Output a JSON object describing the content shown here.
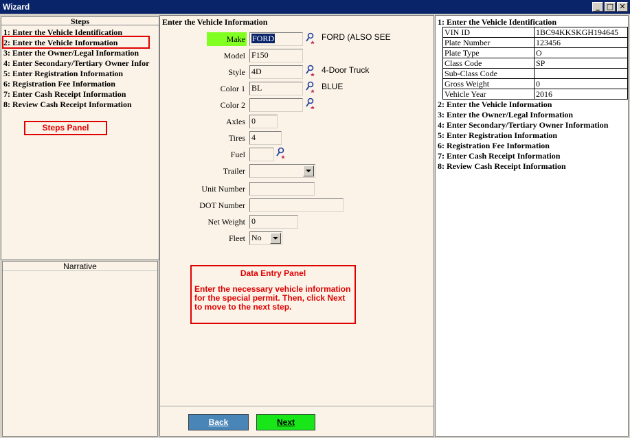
{
  "window": {
    "title": "Wizard",
    "controls": [
      "_",
      "□",
      "✕"
    ]
  },
  "steps_panel": {
    "header": "Steps",
    "items": [
      "1: Enter the Vehicle Identification",
      "2: Enter the Vehicle Information",
      "3: Enter the Owner/Legal Information",
      "4: Enter  Secondary/Tertiary Owner Infor",
      "5: Enter Registration Information",
      "6: Registration Fee Information",
      "7: Enter Cash Receipt Information",
      "8: Review Cash Receipt Information"
    ],
    "annotation": "Steps Panel"
  },
  "narrative": {
    "header": "Narrative"
  },
  "form": {
    "heading": "Enter the Vehicle Information",
    "fields": {
      "make": {
        "label": "Make",
        "value": "FORD",
        "desc": "FORD (ALSO SEE"
      },
      "model": {
        "label": "Model",
        "value": "F150"
      },
      "style": {
        "label": "Style",
        "value": "4D",
        "desc": "4-Door Truck"
      },
      "color1": {
        "label": "Color 1",
        "value": "BL",
        "desc": "BLUE"
      },
      "color2": {
        "label": "Color 2",
        "value": ""
      },
      "axles": {
        "label": "Axles",
        "value": "0"
      },
      "tires": {
        "label": "Tires",
        "value": "4"
      },
      "fuel": {
        "label": "Fuel",
        "value": ""
      },
      "trailer": {
        "label": "Trailer",
        "value": ""
      },
      "unit_number": {
        "label": "Unit Number",
        "value": ""
      },
      "dot_number": {
        "label": "DOT Number",
        "value": ""
      },
      "net_weight": {
        "label": "Net Weight",
        "value": "0"
      },
      "fleet": {
        "label": "Fleet",
        "value": "No"
      }
    },
    "annotation": {
      "title": "Data Entry Panel",
      "body": "Enter the necessary vehicle information for the special permit.  Then, click Next to move to the next step."
    },
    "buttons": {
      "back": "Back",
      "next": "Next"
    }
  },
  "summary_panel": {
    "step1_title": "1: Enter the Vehicle Identification",
    "identification": [
      {
        "label": "VIN ID",
        "value": "1BC94KKSKGH194645"
      },
      {
        "label": "Plate Number",
        "value": "123456"
      },
      {
        "label": "Plate Type",
        "value": "O"
      },
      {
        "label": "Class Code",
        "value": "SP"
      },
      {
        "label": "Sub-Class Code",
        "value": ""
      },
      {
        "label": "Gross Weight",
        "value": "0"
      },
      {
        "label": "Vehicle Year",
        "value": "2016"
      }
    ],
    "steps": [
      "2: Enter the Vehicle Information",
      "3: Enter the Owner/Legal Information",
      "4: Enter Secondary/Tertiary Owner Information",
      "5: Enter Registration Information",
      "6: Registration Fee Information",
      "7: Enter Cash Receipt Information",
      "8: Review Cash Receipt Information"
    ]
  },
  "colors": {
    "titlebar": "#0a246a",
    "panel_bg": "#fbf3e8",
    "highlight_label": "#80ff20",
    "annotation_red": "#e00000",
    "back_button": "#4a85b8",
    "next_button": "#19e619"
  }
}
